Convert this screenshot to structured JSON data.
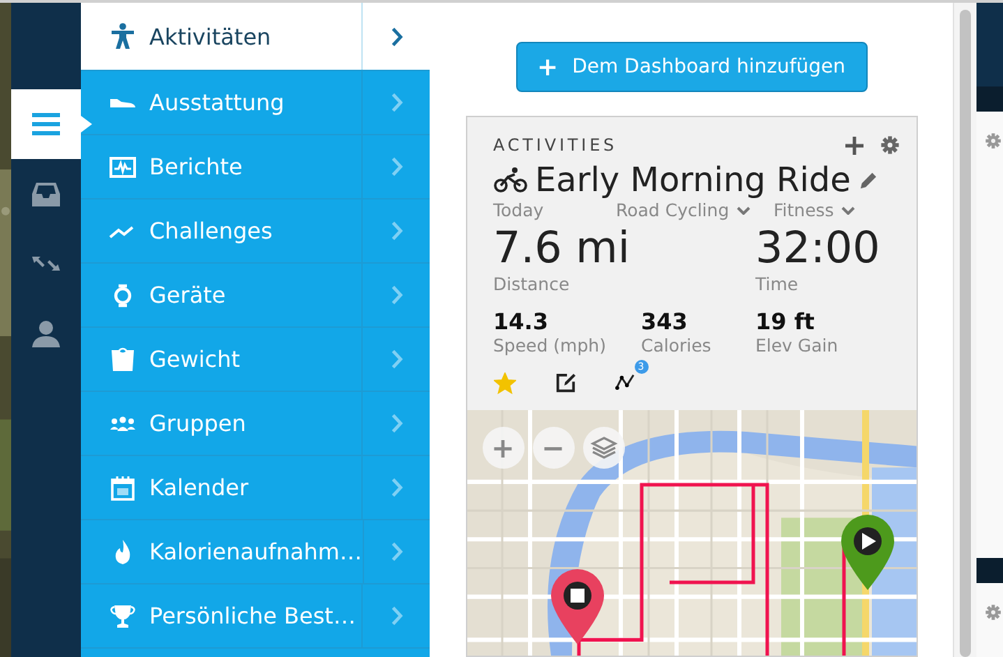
{
  "sidebar": {
    "items": [
      {
        "kind": "menu",
        "selected": true
      },
      {
        "kind": "inbox",
        "selected": false
      },
      {
        "kind": "sync",
        "selected": false
      },
      {
        "kind": "profile",
        "selected": false
      }
    ]
  },
  "nav": {
    "items": [
      {
        "kind": "runner",
        "label": "Aktivitäten",
        "selected": true
      },
      {
        "kind": "shoe",
        "label": "Ausstattung",
        "selected": false
      },
      {
        "kind": "chart",
        "label": "Berichte",
        "selected": false
      },
      {
        "kind": "challenge",
        "label": "Challenges",
        "selected": false
      },
      {
        "kind": "watch",
        "label": "Geräte",
        "selected": false
      },
      {
        "kind": "scale",
        "label": "Gewicht",
        "selected": false
      },
      {
        "kind": "group",
        "label": "Gruppen",
        "selected": false
      },
      {
        "kind": "calendar",
        "label": "Kalender",
        "selected": false
      },
      {
        "kind": "flame",
        "label": "Kalorienaufnahm…",
        "selected": false
      },
      {
        "kind": "trophy",
        "label": "Persönliche Best…",
        "selected": false
      }
    ]
  },
  "add_button": {
    "icon": "+",
    "label": "Dem Dashboard hinzufügen"
  },
  "card": {
    "heading": "ACTIVITIES",
    "title": "Early Morning Ride",
    "date": "Today",
    "activity_type": "Road Cycling",
    "event_type": "Fitness",
    "distance": {
      "value": "7.6 mi",
      "label": "Distance"
    },
    "time": {
      "value": "32:00",
      "label": "Time"
    },
    "stats": [
      {
        "value": "14.3",
        "label": "Speed (mph)"
      },
      {
        "value": "343",
        "label": "Calories"
      },
      {
        "value": "19 ft",
        "label": "Elev Gain"
      }
    ],
    "starred": true,
    "route_badge": "3",
    "map": {
      "kind": "picture",
      "zoom_in": "+",
      "zoom_out": "−"
    }
  }
}
